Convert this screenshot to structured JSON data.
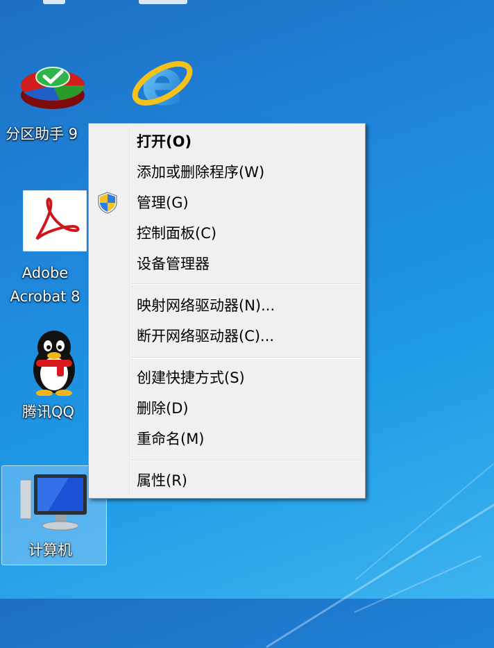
{
  "desktop": {
    "icons": [
      {
        "label": "分区助手 9"
      },
      {
        "label": "Adobe"
      },
      {
        "label": "Acrobat 8"
      },
      {
        "label": "腾讯QQ"
      },
      {
        "label": "计算机"
      }
    ]
  },
  "context_menu": {
    "items": [
      {
        "label": "打开(O)",
        "bold": true
      },
      {
        "label": "添加或删除程序(W)"
      },
      {
        "label": "管理(G)",
        "icon": "uac-shield-icon"
      },
      {
        "label": "控制面板(C)"
      },
      {
        "label": "设备管理器"
      },
      {
        "label": "映射网络驱动器(N)..."
      },
      {
        "label": "断开网络驱动器(C)..."
      },
      {
        "label": "创建快捷方式(S)"
      },
      {
        "label": "删除(D)"
      },
      {
        "label": "重命名(M)"
      },
      {
        "label": "属性(R)"
      }
    ]
  },
  "colors": {
    "desktop_blue": "#1f86db",
    "menu_background": "#f0f0f0",
    "menu_border": "#9b9b9b"
  }
}
